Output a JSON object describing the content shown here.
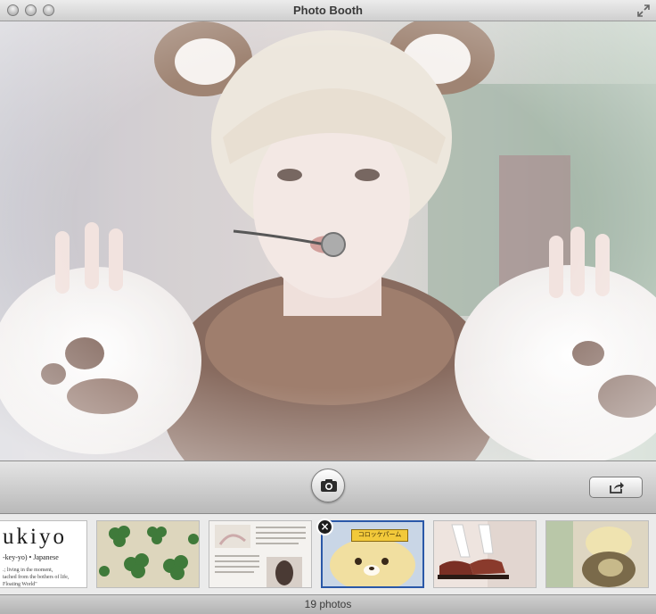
{
  "window": {
    "title": "Photo Booth"
  },
  "toolbar": {
    "shutter_icon": "camera-icon",
    "share_icon": "share-icon"
  },
  "strip": {
    "thumbnails": [
      {
        "kind": "text-page",
        "title": "ukiyo",
        "subtitle": "-key-yo) • Japanese",
        "lines": [
          ".; living in the moment,",
          "tached from the bothers of life,",
          "Floating World\""
        ]
      },
      {
        "kind": "clover-photo"
      },
      {
        "kind": "magazine-page"
      },
      {
        "kind": "rilakkuma-photo",
        "label": "コロッケパーム",
        "selected": true
      },
      {
        "kind": "shoes-photo"
      },
      {
        "kind": "plush-photo"
      }
    ],
    "delete_icon": "close-icon"
  },
  "status": {
    "count_label": "19 photos"
  }
}
